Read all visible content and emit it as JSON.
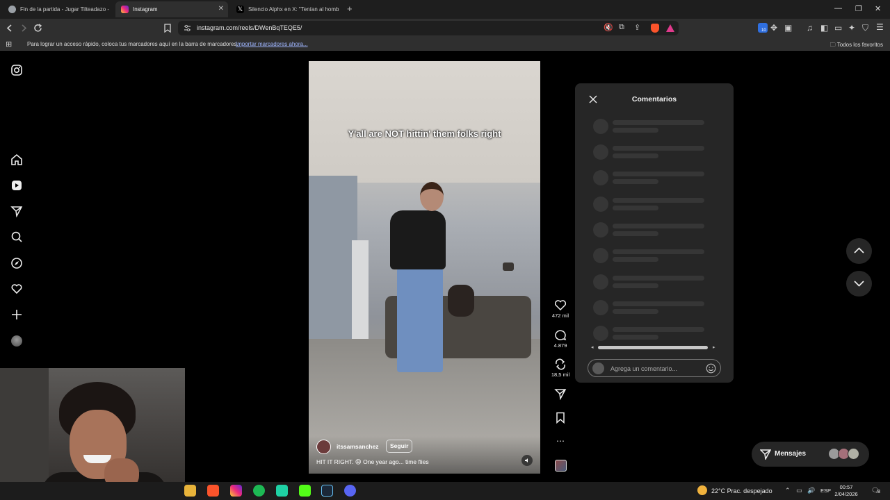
{
  "browser": {
    "tabs": [
      {
        "title": "Fin de la partida - Jugar Tilteadazo -",
        "active": false,
        "icon_color": "#9aa0a6"
      },
      {
        "title": "Instagram",
        "active": true,
        "icon_color": "#e1306c"
      },
      {
        "title": "Silencio Alphx en X: \"Tenían al homb",
        "active": false,
        "icon_color": "#000000"
      }
    ],
    "new_tab_label": "+",
    "url": "instagram.com/reels/DWenBqTEQE5/",
    "bookmarks_hint": "Para lograr un acceso rápido, coloca tus marcadores aquí en la barra de marcadores.",
    "bookmarks_import_link": "Importar marcadores ahora...",
    "all_favorites": "Todos los favoritos",
    "extension_badge": "10"
  },
  "reel": {
    "overlay_text": "Y'all are NOT hittin' them folks right",
    "username": "itssamsanchez",
    "follow_label": "Seguir",
    "caption": "HIT IT RIGHT. 😩 One year ago... time flies"
  },
  "actions": {
    "likes": "472 mil",
    "comments": "4.879",
    "reposts": "18,5 mil"
  },
  "comments_panel": {
    "title": "Comentarios",
    "input_placeholder": "Agrega un comentario..."
  },
  "messages": {
    "label": "Mensajes"
  },
  "taskbar": {
    "weather": "22°C  Prac. despejado",
    "language": "ESP",
    "time": "00:57",
    "date": "2/04/2026",
    "notifications": "8"
  },
  "colors": {
    "accent_link": "#9fb6ff",
    "panel_bg": "#262626",
    "page_bg": "#000000"
  }
}
